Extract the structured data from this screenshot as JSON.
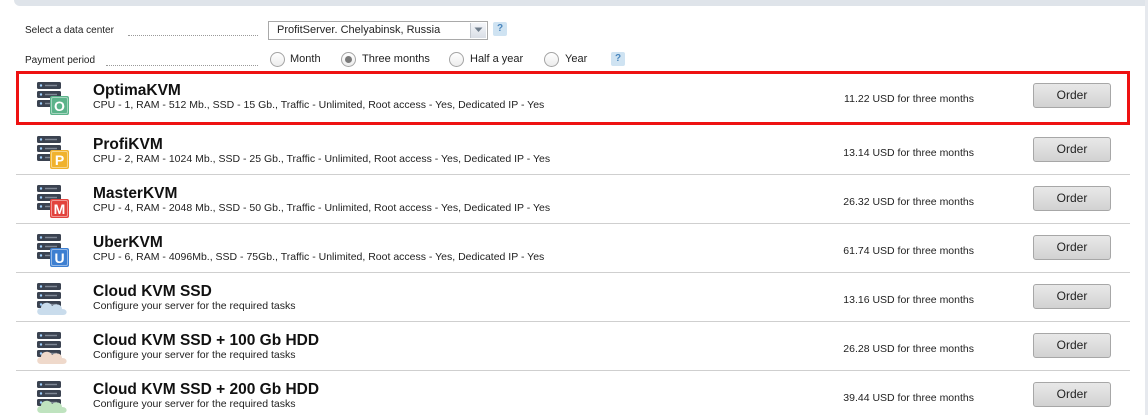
{
  "form": {
    "datacenter_label": "Select a data center",
    "datacenter_value": "ProfitServer. Chelyabinsk, Russia",
    "period_label": "Payment period",
    "help_glyph": "?",
    "periods": [
      {
        "label": "Month",
        "checked": false
      },
      {
        "label": "Three months",
        "checked": true
      },
      {
        "label": "Half a year",
        "checked": false
      },
      {
        "label": "Year",
        "checked": false
      }
    ]
  },
  "order_label": "Order",
  "plans": [
    {
      "name": "OptimaKVM",
      "desc": "CPU - 1, RAM - 512 Mb., SSD - 15 Gb., Traffic - Unlimited, Root access - Yes, Dedicated IP - Yes",
      "price": "11.22 USD for three months",
      "icon": "server-icon-letter",
      "letter": "O",
      "badge_color": "#5bb38a",
      "highlighted": true
    },
    {
      "name": "ProfiKVM",
      "desc": "CPU - 2, RAM - 1024 Mb., SSD - 25 Gb., Traffic - Unlimited, Root access - Yes, Dedicated IP - Yes",
      "price": "13.14 USD for three months",
      "icon": "server-icon-letter",
      "letter": "P",
      "badge_color": "#f0b22e",
      "highlighted": false
    },
    {
      "name": "MasterKVM",
      "desc": "CPU - 4, RAM - 2048 Mb., SSD - 50 Gb., Traffic - Unlimited, Root access - Yes, Dedicated IP - Yes",
      "price": "26.32 USD for three months",
      "icon": "server-icon-letter",
      "letter": "M",
      "badge_color": "#e2433d",
      "highlighted": false
    },
    {
      "name": "UberKVM",
      "desc": "CPU - 6, RAM - 4096Mb., SSD - 75Gb., Traffic - Unlimited, Root access - Yes, Dedicated IP - Yes",
      "price": "61.74 USD for three months",
      "icon": "server-icon-letter",
      "letter": "U",
      "badge_color": "#3d7fd1",
      "highlighted": false
    },
    {
      "name": "Cloud KVM SSD",
      "desc": "Configure your server for the required tasks",
      "price": "13.16 USD for three months",
      "icon": "server-cloud-icon",
      "letter": "",
      "badge_color": "#c9dcec",
      "highlighted": false
    },
    {
      "name": "Cloud KVM SSD + 100 Gb HDD",
      "desc": "Configure your server for the required tasks",
      "price": "26.28 USD for three months",
      "icon": "server-cloud-icon",
      "letter": "",
      "badge_color": "#efd9cb",
      "highlighted": false
    },
    {
      "name": "Cloud KVM SSD + 200 Gb HDD",
      "desc": "Configure your server for the required tasks",
      "price": "39.44 USD for three months",
      "icon": "server-cloud-icon",
      "letter": "",
      "badge_color": "#bfe3bf",
      "highlighted": false
    }
  ]
}
